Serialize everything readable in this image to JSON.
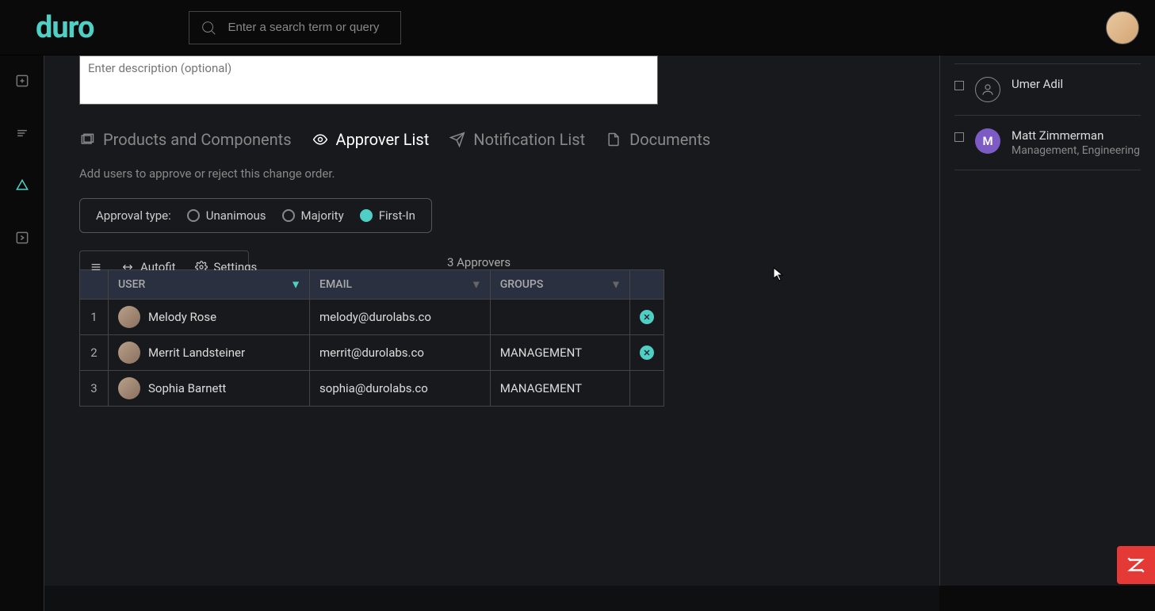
{
  "header": {
    "logo": "duro",
    "search_placeholder": "Enter a search term or query"
  },
  "description": {
    "placeholder": "Enter description (optional)"
  },
  "tabs": {
    "products": "Products and Components",
    "approver": "Approver List",
    "notification": "Notification List",
    "documents": "Documents"
  },
  "helper_text": "Add users to approve or reject this change order.",
  "approval": {
    "label": "Approval type:",
    "unanimous": "Unanimous",
    "majority": "Majority",
    "first_in": "First-In"
  },
  "toolbar": {
    "autofit": "Autofit",
    "settings": "Settings"
  },
  "approver_count": "3 Approvers",
  "table": {
    "headers": {
      "user": "USER",
      "email": "EMAIL",
      "groups": "GROUPS"
    },
    "rows": [
      {
        "num": "1",
        "name": "Melody Rose",
        "email": "melody@durolabs.co",
        "groups": "",
        "removable": true
      },
      {
        "num": "2",
        "name": "Merrit Landsteiner",
        "email": "merrit@durolabs.co",
        "groups": "MANAGEMENT",
        "removable": true
      },
      {
        "num": "3",
        "name": "Sophia Barnett",
        "email": "sophia@durolabs.co",
        "groups": "MANAGEMENT",
        "removable": false
      }
    ]
  },
  "right_panel": {
    "items": [
      {
        "name": "Umer Adil",
        "sub": "",
        "initial": "",
        "outline": true
      },
      {
        "name": "Matt Zimmerman",
        "sub": "Management, Engineering",
        "initial": "M",
        "outline": false
      }
    ]
  }
}
